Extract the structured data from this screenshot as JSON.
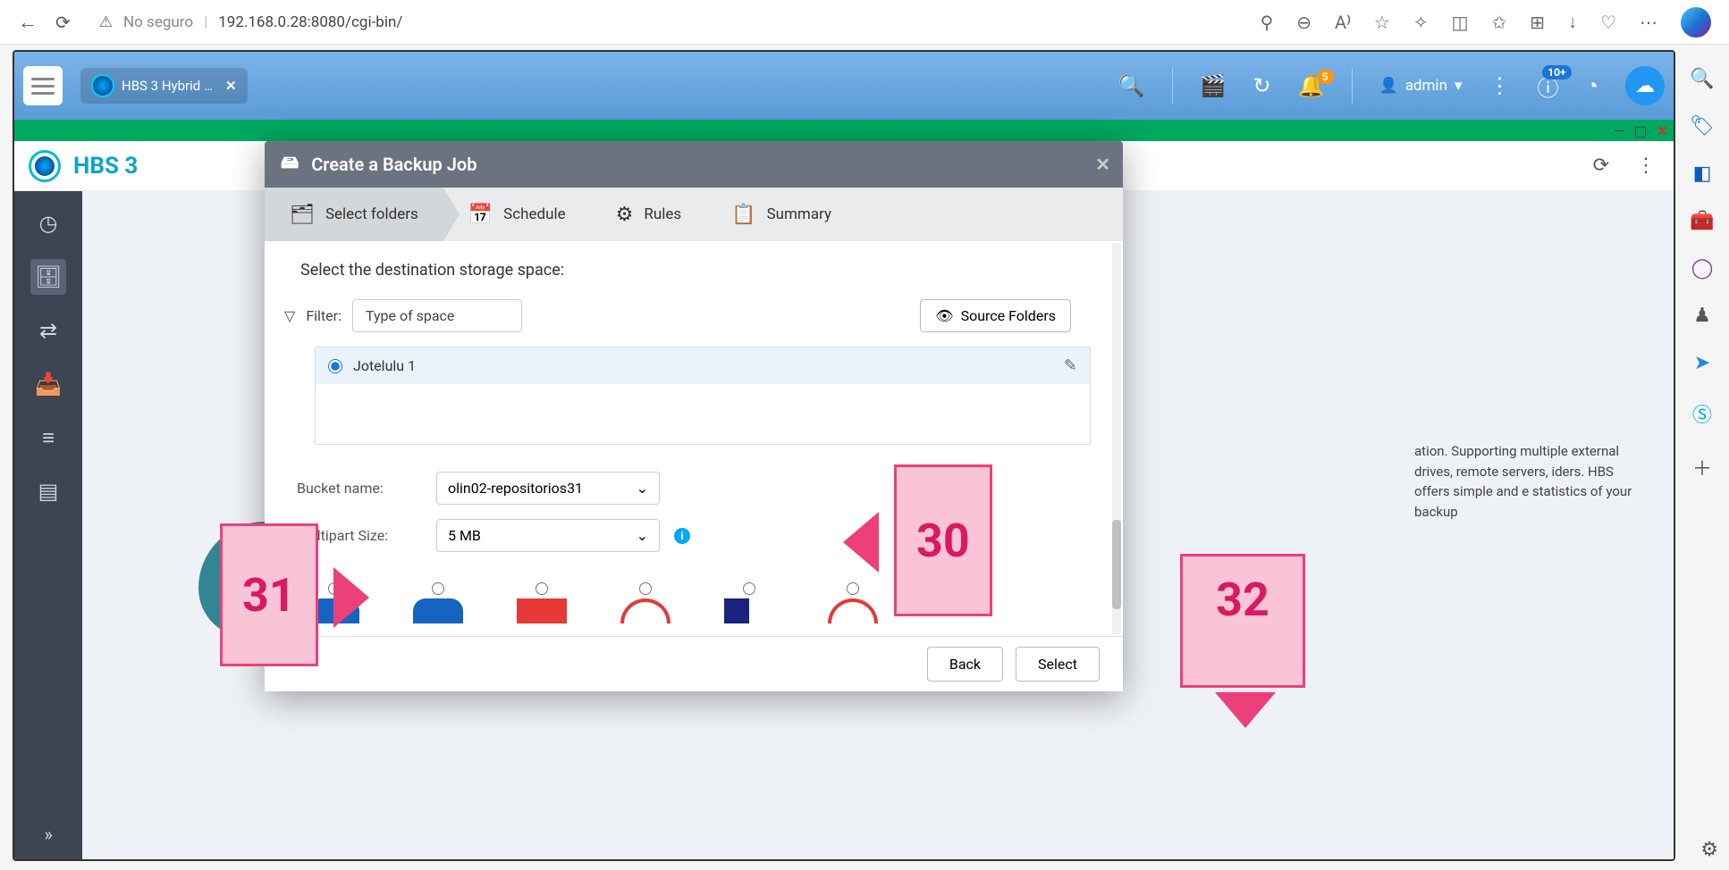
{
  "browser": {
    "insecure_label": "No seguro",
    "url": "192.168.0.28:8080/cgi-bin/"
  },
  "qnap": {
    "app_tab_title": "HBS 3 Hybrid …",
    "user": "admin",
    "notif_badge": "5",
    "info_badge": "10+"
  },
  "hbs": {
    "title": "HBS 3",
    "bg_text": "ation. Supporting multiple external drives, remote servers, iders. HBS offers simple and e statistics of your backup"
  },
  "modal": {
    "title": "Create a Backup Job",
    "tabs": {
      "select_folders": "Select folders",
      "schedule": "Schedule",
      "rules": "Rules",
      "summary": "Summary"
    },
    "section_heading": "Select the destination storage space:",
    "filter_label": "Filter:",
    "type_of_space": "Type of space",
    "source_folders_btn": "Source Folders",
    "destination": {
      "name": "Jotelulu 1"
    },
    "bucket": {
      "label": "Bucket name:",
      "value": "olin02-repositorios31"
    },
    "multipart": {
      "label": "Multipart Size:",
      "value": "5 MB"
    },
    "footer": {
      "back": "Back",
      "select": "Select"
    }
  },
  "callouts": {
    "c30": "30",
    "c31": "31",
    "c32": "32"
  }
}
